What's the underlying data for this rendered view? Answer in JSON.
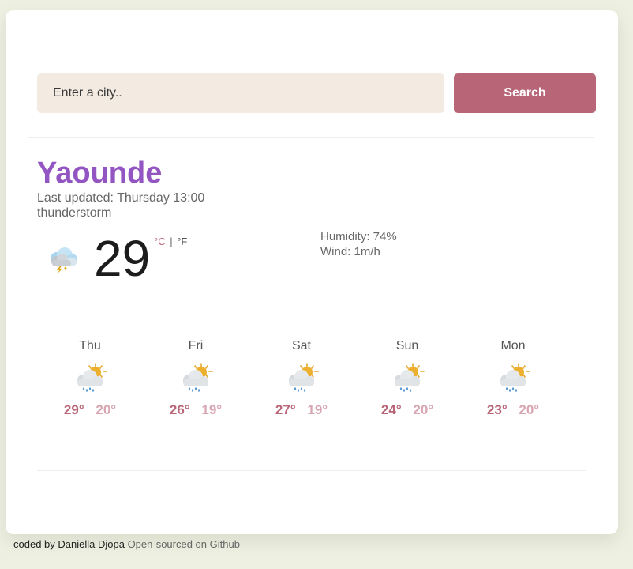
{
  "search": {
    "placeholder": "Enter a city..",
    "value": "",
    "button_label": "Search"
  },
  "current": {
    "city": "Yaounde",
    "updated": "Last updated: Thursday 13:00",
    "description": "thunderstorm",
    "temperature": "29",
    "unit_celsius": "°C",
    "unit_separator": "|",
    "unit_fahrenheit": "°F",
    "humidity": "Humidity: 74%",
    "wind": "Wind: 1m/h",
    "icon": "thunderstorm-icon"
  },
  "forecast": [
    {
      "day": "Thu",
      "max": "29°",
      "min": "20°",
      "icon": "rain-sun-icon"
    },
    {
      "day": "Fri",
      "max": "26°",
      "min": "19°",
      "icon": "rain-sun-icon"
    },
    {
      "day": "Sat",
      "max": "27°",
      "min": "19°",
      "icon": "rain-sun-icon"
    },
    {
      "day": "Sun",
      "max": "24°",
      "min": "20°",
      "icon": "rain-sun-icon"
    },
    {
      "day": "Mon",
      "max": "23°",
      "min": "20°",
      "icon": "rain-sun-icon"
    }
  ],
  "footer": {
    "credit": "coded by Daniella Djopa",
    "link": "Open-sourced on Github"
  },
  "colors": {
    "accent": "#b86677",
    "city": "#9355c2",
    "input_bg": "#f3ebe1",
    "page_bg": "#eef0e2"
  }
}
